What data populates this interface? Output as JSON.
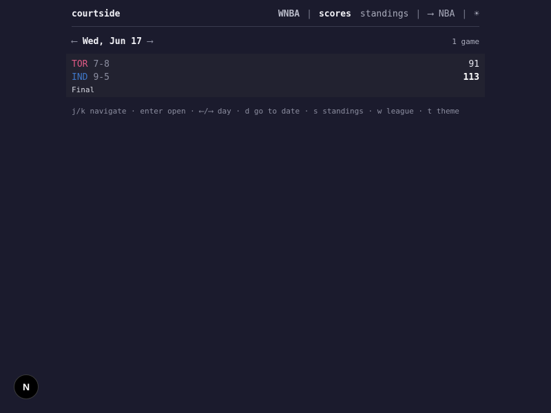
{
  "app": {
    "brand": "courtside"
  },
  "nav": {
    "league": "WNBA",
    "sep1": "|",
    "scores": "scores",
    "standings": "standings",
    "sep2": "|",
    "switch_league": "⟶ NBA",
    "sep3": "|",
    "theme_icon": "☀"
  },
  "date_nav": {
    "prev_arrow": "⟵",
    "label": "Wed, Jun 17",
    "next_arrow": "⟶",
    "game_count": "1 game"
  },
  "games": [
    {
      "away": {
        "abbr": "TOR",
        "record": "7-8",
        "score": "91",
        "color": "#e05a86"
      },
      "home": {
        "abbr": "IND",
        "record": "9-5",
        "score": "113",
        "color": "#3f77c8"
      },
      "status": "Final"
    }
  ],
  "help": {
    "text": "j/k navigate · enter open · ⟵/⟶ day · d go to date · s standings · w league · t theme"
  },
  "badge": {
    "letter": "N"
  }
}
